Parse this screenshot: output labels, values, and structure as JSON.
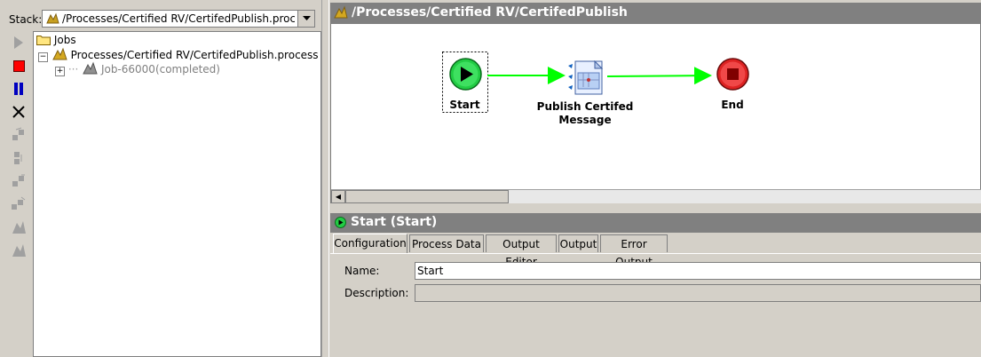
{
  "stack": {
    "label": "Stack:",
    "value": "/Processes/Certified RV/CertifedPublish.proce..."
  },
  "toolbar": {
    "icons": [
      "play-icon",
      "stop-icon",
      "pause-icon",
      "close-icon",
      "step-into-icon",
      "step-over-icon",
      "step-out-icon",
      "step-next-icon",
      "bean-icon-1",
      "bean-icon-2"
    ],
    "stop_color": "#ff0000",
    "pause_color": "#0000c0"
  },
  "tree": {
    "root": "Jobs",
    "process": "Processes/Certified RV/CertifedPublish.process",
    "job": "Job-66000(completed)"
  },
  "process_panel": {
    "title": "/Processes/Certified RV/CertifedPublish",
    "nodes": {
      "start": "Start",
      "publish_line1": "Publish Certifed",
      "publish_line2": "Message",
      "end": "End"
    },
    "colors": {
      "arrow": "#00ff00",
      "start": "#22cc44",
      "end": "#dd2222"
    }
  },
  "activity_panel": {
    "title": "Start (Start)",
    "tabs": [
      "Configuration",
      "Process Data",
      "Output Editor",
      "Output",
      "Error Output"
    ],
    "active_tab": "Configuration",
    "fields": {
      "name_label": "Name:",
      "name_value": "Start",
      "description_label": "Description:",
      "description_value": ""
    }
  }
}
